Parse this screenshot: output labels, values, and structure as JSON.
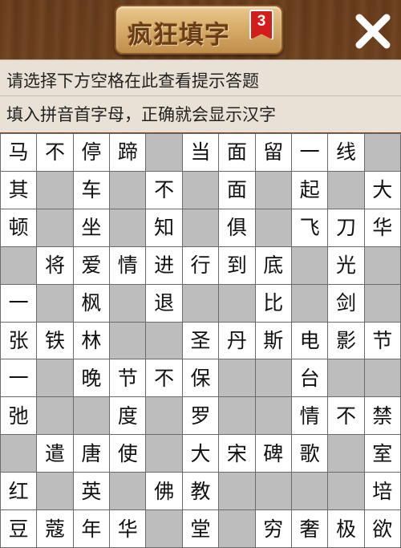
{
  "header": {
    "title": "疯狂填字",
    "level": "3"
  },
  "hints": {
    "line1": "请选择下方空格在此查看提示答题",
    "line2": "填入拼音首字母，正确就会显示汉字"
  },
  "grid": [
    [
      "马",
      "不",
      "停",
      "蹄",
      "",
      "当",
      "面",
      "留",
      "一",
      "线",
      ""
    ],
    [
      "其",
      "",
      "车",
      "",
      "不",
      "",
      "面",
      "",
      "起",
      "",
      "大"
    ],
    [
      "顿",
      "",
      "坐",
      "",
      "知",
      "",
      "俱",
      "",
      "飞",
      "刀",
      "华"
    ],
    [
      "",
      "将",
      "爱",
      "情",
      "进",
      "行",
      "到",
      "底",
      "",
      "光",
      ""
    ],
    [
      "一",
      "",
      "枫",
      "",
      "退",
      "",
      "",
      "比",
      "",
      "剑",
      ""
    ],
    [
      "张",
      "铁",
      "林",
      "",
      "",
      "圣",
      "丹",
      "斯",
      "电",
      "影",
      "节"
    ],
    [
      "一",
      "",
      "晚",
      "节",
      "不",
      "保",
      "",
      "",
      "台",
      "",
      ""
    ],
    [
      "弛",
      "",
      "",
      "度",
      "",
      "罗",
      "",
      "",
      "情",
      "不",
      "禁"
    ],
    [
      "",
      "遣",
      "唐",
      "使",
      "",
      "大",
      "宋",
      "碑",
      "歌",
      "",
      "室"
    ],
    [
      "红",
      "",
      "英",
      "",
      "佛",
      "教",
      "",
      "",
      "",
      "",
      "培"
    ],
    [
      "豆",
      "蔻",
      "年",
      "华",
      "",
      "堂",
      "",
      "穷",
      "奢",
      "极",
      "欲"
    ]
  ]
}
